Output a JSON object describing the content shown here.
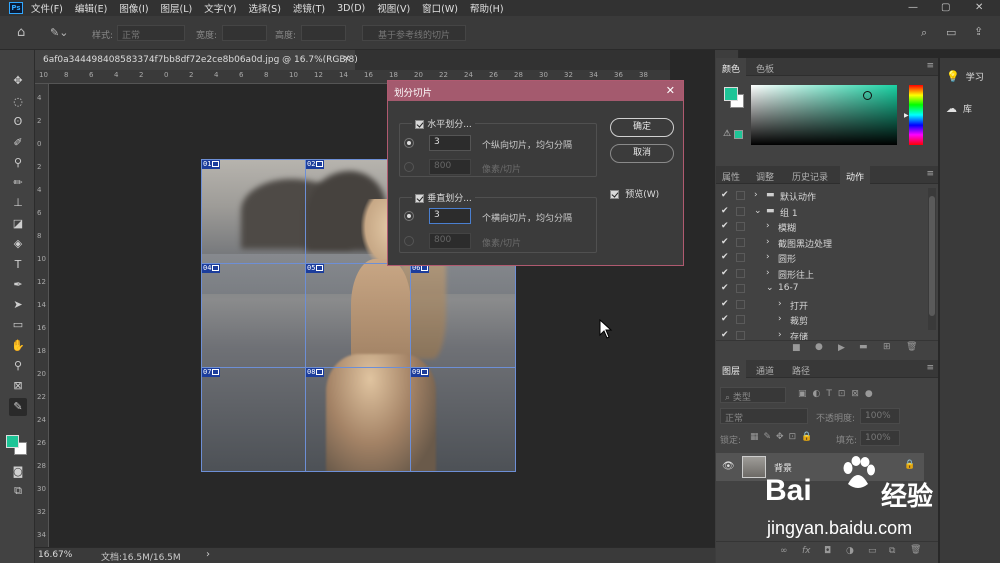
{
  "app": {
    "logo": "Ps"
  },
  "menu": [
    "文件(F)",
    "编辑(E)",
    "图像(I)",
    "图层(L)",
    "文字(Y)",
    "选择(S)",
    "滤镜(T)",
    "3D(D)",
    "视图(V)",
    "窗口(W)",
    "帮助(H)"
  ],
  "window_controls": [
    "—",
    "▢",
    "✕"
  ],
  "options_bar": {
    "style_label": "样式:",
    "style_value": "正常",
    "width_label": "宽度:",
    "height_label": "高度:",
    "guides_button": "基于参考线的切片"
  },
  "document": {
    "tab_title": "6af0a344498408583374f7bb8df72e2ce8b06a0d.jpg @ 16.7%(RGB/8)",
    "close": "×",
    "ruler_h": [
      "10",
      "8",
      "6",
      "4",
      "2",
      "0",
      "2",
      "4",
      "6",
      "8",
      "10",
      "12",
      "14",
      "16",
      "18",
      "20",
      "22",
      "24",
      "26",
      "28",
      "30",
      "32",
      "34",
      "36",
      "38"
    ],
    "ruler_v": [
      "4",
      "2",
      "0",
      "2",
      "4",
      "6",
      "8",
      "10",
      "12",
      "14",
      "16",
      "18",
      "20",
      "22",
      "24",
      "26",
      "28",
      "30",
      "32",
      "34"
    ],
    "slices": [
      "01",
      "02",
      "03",
      "04",
      "05",
      "06",
      "07",
      "08",
      "09"
    ]
  },
  "status": {
    "zoom": "16.67%",
    "doc_size": "文档:16.5M/16.5M",
    "arrow": "›"
  },
  "dialog": {
    "title": "划分切片",
    "close": "✕",
    "horizontal": {
      "label": "水平划分...",
      "count_value": "3",
      "count_label": "个纵向切片，均匀分隔",
      "pixel_value": "800",
      "pixel_label": "像素/切片"
    },
    "vertical": {
      "label": "垂直划分...",
      "count_value": "3",
      "count_label": "个横向切片，均匀分隔",
      "pixel_value": "800",
      "pixel_label": "像素/切片"
    },
    "ok": "确定",
    "cancel": "取消",
    "preview": "预览(W)"
  },
  "color_panel": {
    "tabs": [
      "颜色",
      "色板"
    ],
    "foreground": "#1ec597",
    "background": "#ffffff"
  },
  "learn_panel": {
    "items": [
      "学习",
      "库"
    ]
  },
  "actions_panel": {
    "tabs": [
      "属性",
      "调整",
      "历史记录",
      "动作"
    ],
    "rows": [
      {
        "label": "默认动作",
        "indent": 0,
        "arrow": "›",
        "folder": true
      },
      {
        "label": "组 1",
        "indent": 0,
        "arrow": "⌄",
        "folder": true
      },
      {
        "label": "模糊",
        "indent": 1,
        "arrow": "›",
        "folder": false
      },
      {
        "label": "截图黑边处理",
        "indent": 1,
        "arrow": "›",
        "folder": false
      },
      {
        "label": "圆形",
        "indent": 1,
        "arrow": "›",
        "folder": false
      },
      {
        "label": "圆形往上",
        "indent": 1,
        "arrow": "›",
        "folder": false
      },
      {
        "label": "16-7",
        "indent": 1,
        "arrow": "⌄",
        "folder": false
      },
      {
        "label": "打开",
        "indent": 2,
        "arrow": "›",
        "folder": false
      },
      {
        "label": "裁剪",
        "indent": 2,
        "arrow": "›",
        "folder": false
      },
      {
        "label": "存储",
        "indent": 2,
        "arrow": "›",
        "folder": false
      }
    ]
  },
  "layers_panel": {
    "tabs": [
      "图层",
      "通道",
      "路径"
    ],
    "filter_label": "类型",
    "blend_mode": "正常",
    "opacity_label": "不透明度:",
    "opacity_value": "100%",
    "lock_label": "锁定:",
    "fill_label": "填充:",
    "fill_value": "100%",
    "layer_name": "背景",
    "footer_icons": [
      "∞",
      "fx",
      "◘",
      "◑",
      "▭",
      "⧉",
      "🗑"
    ]
  },
  "watermark": {
    "brand": "Bai",
    "brand2": "经验",
    "url": "jingyan.baidu.com"
  }
}
